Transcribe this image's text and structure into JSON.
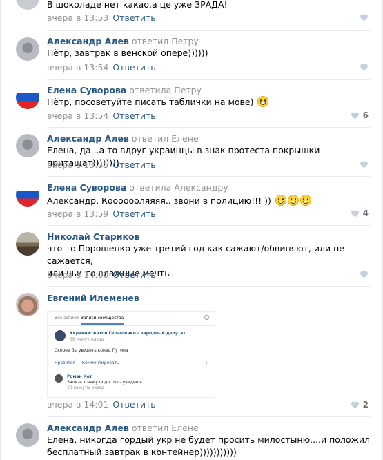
{
  "answer_label": "Ответить",
  "comments": [
    {
      "text": "В шоколаде нет какао,а це уже ЗРАДА!",
      "time": "вчера в 13:53",
      "likes": ""
    },
    {
      "author": "Александр Алев",
      "reply_to": "ответил Петру",
      "text": "Пётр, завтрак в венской опере))))))",
      "time": "вчера в 13:54",
      "likes": ""
    },
    {
      "author": "Елена Суворова",
      "reply_to": "ответила Петру",
      "text": "Пётр, посоветуйте писать таблички на мове)",
      "time": "вчера в 13:54",
      "likes": "6"
    },
    {
      "author": "Александр Алев",
      "reply_to": "ответил Елене",
      "text": "Елена, да...а то вдруг украинцы в знак протеста покрышки притащат))))))))",
      "time": "вчера в 13:55",
      "likes": ""
    },
    {
      "author": "Елена Суворова",
      "reply_to": "ответила Александру",
      "text": "Александр, Кооооооляяяя.. звони в полицию!!! ))",
      "time": "вчера в 13:59",
      "likes": "4"
    },
    {
      "author": "Николай Стариков",
      "reply_to": "",
      "text": "что-то Порошенко уже третий год как сажают/обвиняют, или не сажается,\nили чьи-то влажные мечты.",
      "time": "вчера в 14:00",
      "likes": ""
    },
    {
      "author": "Евгений Илеменев",
      "reply_to": "",
      "text": "",
      "time": "вчера в 14:01",
      "likes": "2"
    },
    {
      "author": "Александр Алев",
      "reply_to": "ответил Елене",
      "text": "Елена, никогда гордый укр не будет просить милостыню....и положил\nбесплатный завтрак в контейнер)))))))))))",
      "time": "",
      "likes": ""
    }
  ],
  "attachment": {
    "tab_all": "Все записи",
    "tab_community": "Записи сообщества",
    "post_author": "Украина: Антон Геращенко - народный депутат",
    "post_time": "36 минут назад",
    "post_text": "Скорее бы увидеть конец Путина",
    "like_label": "Нравится",
    "comment_label": "Комментировать",
    "views": "1",
    "comment_author": "Роман Кот",
    "comment_text": "Залезь к нему под стол - увидишь.",
    "comment_time": "33 минуты назад"
  },
  "colors": {
    "link": "#2a5885",
    "muted": "#939393",
    "separator": "#e7e8ec"
  }
}
